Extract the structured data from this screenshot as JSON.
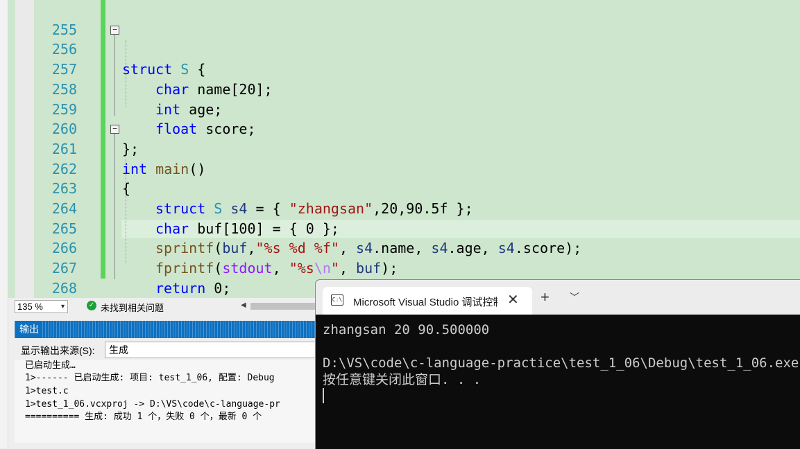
{
  "editor": {
    "lines": [
      {
        "num": "255"
      },
      {
        "num": "256"
      },
      {
        "num": "257"
      },
      {
        "num": "258"
      },
      {
        "num": "259"
      },
      {
        "num": "260"
      },
      {
        "num": "261"
      },
      {
        "num": "262"
      },
      {
        "num": "263"
      },
      {
        "num": "264"
      },
      {
        "num": "265"
      },
      {
        "num": "266"
      },
      {
        "num": "267"
      },
      {
        "num": "268"
      }
    ],
    "code": {
      "l256": {
        "kw": "struct",
        "ty": "S",
        "rest": " {"
      },
      "l257": {
        "kw": "char",
        "rest": " name[20];"
      },
      "l258": {
        "kw": "int",
        "rest": " age;"
      },
      "l259": {
        "kw": "float",
        "rest": " score;"
      },
      "l260": {
        "rest": "};"
      },
      "l261": {
        "kw": "int",
        "fn": "main",
        "rest": "()"
      },
      "l262": {
        "rest": "{"
      },
      "l263": {
        "kw": "struct",
        "ty": "S",
        "va": "s4",
        "eq": " = { ",
        "st": "\"zhangsan\"",
        "rest": ",20,90.5f };"
      },
      "l264": {
        "kw": "char",
        "va": "buf",
        "rest": "[100] = { 0 };"
      },
      "l265": {
        "fn": "sprintf",
        "p1": "(",
        "va1": "buf",
        "p2": ",",
        "st": "\"%s %d %f\"",
        "p3": ", ",
        "va2": "s4",
        "m1": ".name, ",
        "va3": "s4",
        "m2": ".age, ",
        "va4": "s4",
        "m3": ".score);"
      },
      "l266": {
        "fn": "fprintf",
        "p1": "(",
        "mac": "stdout",
        "p2": ", ",
        "st1": "\"%s",
        "esc": "\\n",
        "st2": "\"",
        "p3": ", ",
        "va": "buf",
        "rest": ");"
      },
      "l267": {
        "kw": "return",
        "rest": " 0;"
      },
      "l268": {
        "rest": "}"
      }
    }
  },
  "statusbar": {
    "zoom": "135 %",
    "issues": "未找到相关问题"
  },
  "output": {
    "title": "输出",
    "source_label": "显示输出来源(S):",
    "source_value": "生成",
    "lines": [
      "已启动生成…",
      "1>------ 已启动生成: 项目: test_1_06, 配置: Debug",
      "1>test.c",
      "1>test_1_06.vcxproj -> D:\\VS\\code\\c-language-pr",
      "========== 生成: 成功 1 个，失败 0 个，最新 0 个"
    ]
  },
  "console": {
    "tab_title": "Microsoft Visual Studio 调试控制台",
    "icon_text": "C:\\",
    "new_tab": "+",
    "lines": [
      "zhangsan 20 90.500000",
      "",
      "D:\\VS\\code\\c-language-practice\\test_1_06\\Debug\\test_1_06.exe",
      "按任意键关闭此窗口. . ."
    ]
  },
  "colors": {
    "editor_bg": "#cde6cd",
    "keyword": "#0000ff",
    "type": "#2b91af",
    "function": "#74531f",
    "string": "#a31515",
    "accent": "#0e70c0",
    "console_bg": "#0c0c0c"
  }
}
